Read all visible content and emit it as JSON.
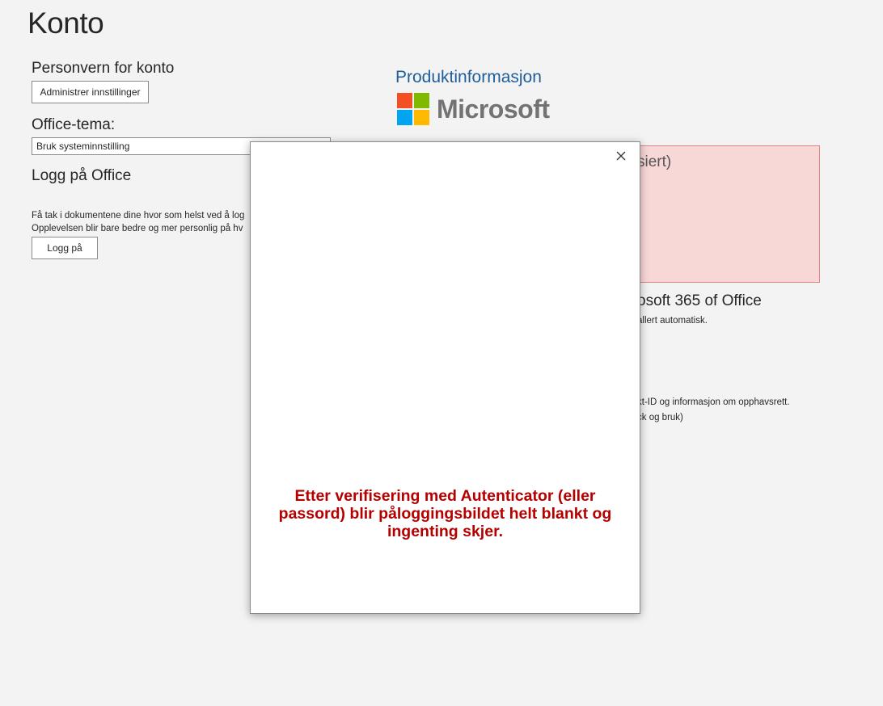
{
  "page": {
    "title": "Konto"
  },
  "privacy": {
    "heading": "Personvern for konto",
    "manage_button": "Administrer innstillinger"
  },
  "theme": {
    "heading": "Office-tema:",
    "selected": "Bruk systeminnstilling"
  },
  "signin": {
    "heading": "Logg på Office",
    "description_line1": "Få tak i dokumentene dine hvor som helst ved å log",
    "description_line2": "Opplevelsen blir bare bedre og mer personlig på hv",
    "button": "Logg på"
  },
  "product": {
    "heading": "Produktinformasjon",
    "brand": "Microsoft",
    "brand_colors": [
      "#f25022",
      "#7fba00",
      "#00a4ef",
      "#ffb900"
    ],
    "activation_partial": "siert)",
    "m365_partial": "osoft 365 of Office",
    "installed_partial": "allert automatisk.",
    "about_partial": "kt-ID og informasjon om opphavsrett.",
    "feedback_partial": "ck og bruk)"
  },
  "dialog": {
    "close_icon": "close-icon",
    "message": "Etter verifisering med Autenticator (eller passord) blir påloggingsbildet helt blankt og ingenting skjer.",
    "message_color": "#b50000"
  }
}
